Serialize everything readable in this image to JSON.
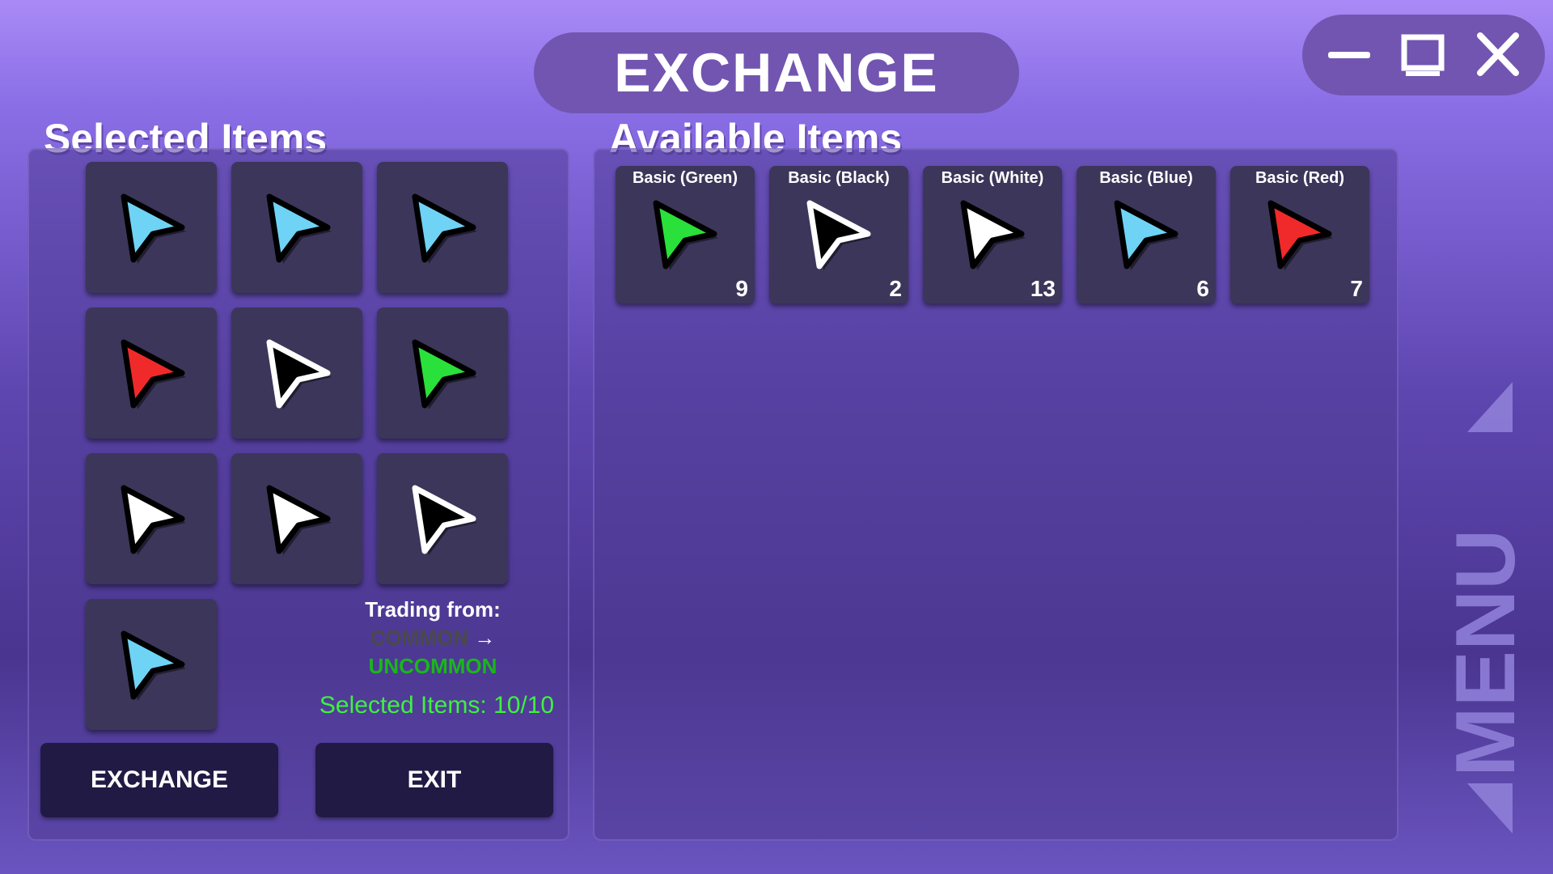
{
  "header": {
    "title": "EXCHANGE"
  },
  "window_controls": {
    "minimize": "minimize-icon",
    "maximize": "maximize-icon",
    "close": "close-icon"
  },
  "selected": {
    "title": "Selected Items",
    "items": [
      {
        "color": "#6fd3f5",
        "outline": "#000000"
      },
      {
        "color": "#6fd3f5",
        "outline": "#000000"
      },
      {
        "color": "#6fd3f5",
        "outline": "#000000"
      },
      {
        "color": "#f02a2a",
        "outline": "#000000"
      },
      {
        "color": "#000000",
        "outline": "#ffffff"
      },
      {
        "color": "#2ae03a",
        "outline": "#000000"
      },
      {
        "color": "#ffffff",
        "outline": "#000000"
      },
      {
        "color": "#ffffff",
        "outline": "#000000"
      },
      {
        "color": "#000000",
        "outline": "#ffffff"
      },
      {
        "color": "#6fd3f5",
        "outline": "#000000"
      }
    ],
    "trading_label": "Trading from:",
    "from_rarity": "COMMON",
    "arrow": "→",
    "to_rarity": "UNCOMMON",
    "count_label": "Selected Items: 10/10",
    "exchange_button": "EXCHANGE",
    "exit_button": "EXIT"
  },
  "available": {
    "title": "Available Items",
    "items": [
      {
        "name": "Basic (Green)",
        "count": "9",
        "color": "#2ae03a",
        "outline": "#000000"
      },
      {
        "name": "Basic (Black)",
        "count": "2",
        "color": "#000000",
        "outline": "#ffffff"
      },
      {
        "name": "Basic (White)",
        "count": "13",
        "color": "#ffffff",
        "outline": "#000000"
      },
      {
        "name": "Basic (Blue)",
        "count": "6",
        "color": "#6fd3f5",
        "outline": "#000000"
      },
      {
        "name": "Basic (Red)",
        "count": "7",
        "color": "#f02a2a",
        "outline": "#000000"
      }
    ]
  },
  "menu_tab": {
    "label": "MENU"
  }
}
